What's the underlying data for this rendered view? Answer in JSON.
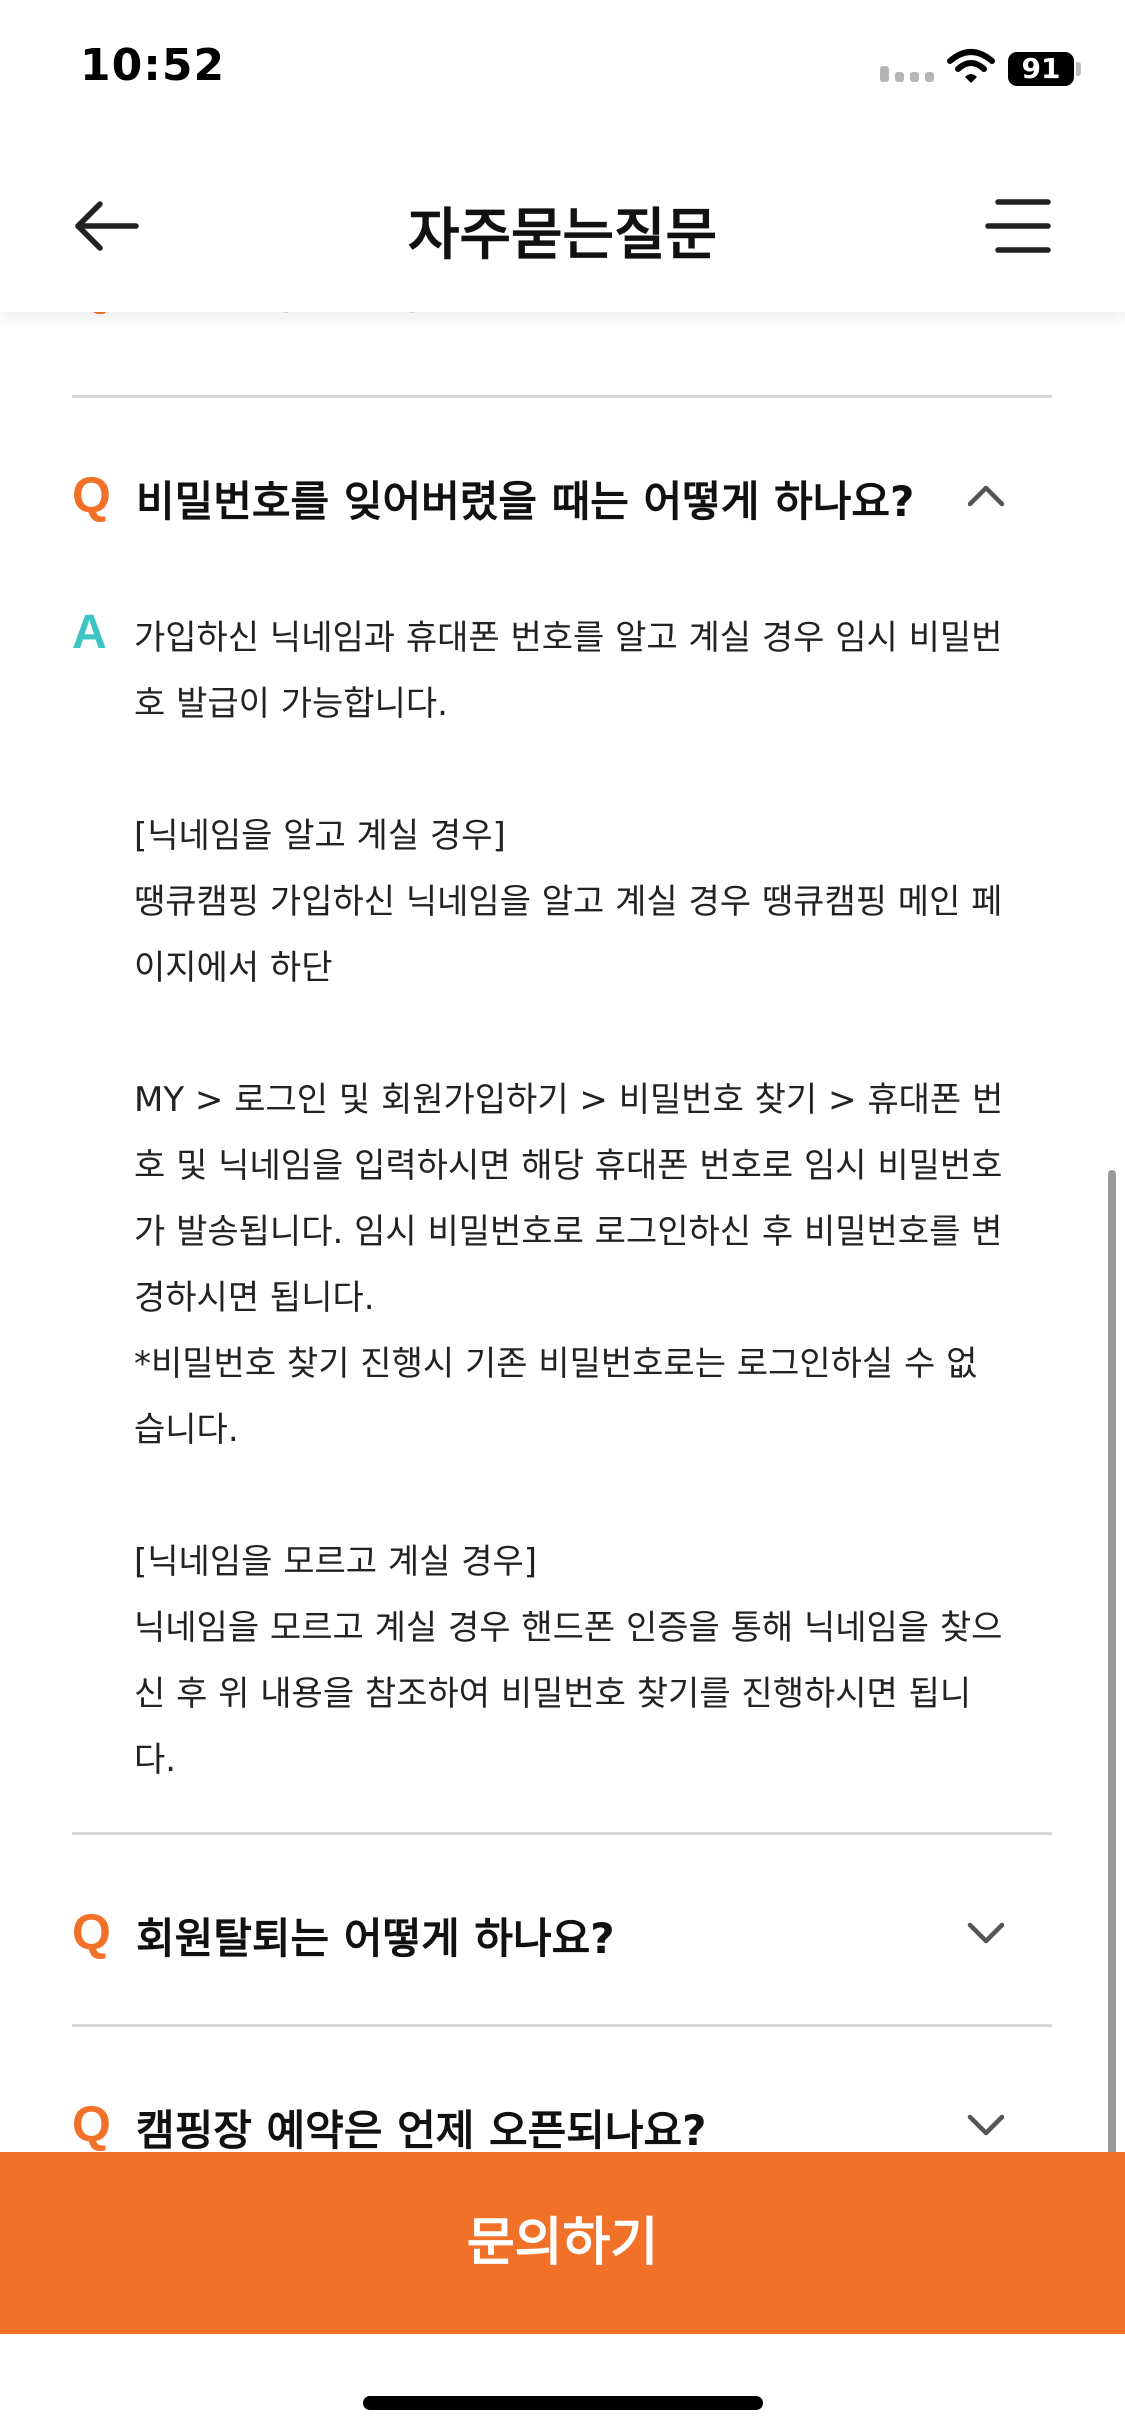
{
  "status": {
    "time": "10:52",
    "battery": "91"
  },
  "header": {
    "title": "자주묻는질문"
  },
  "faq": {
    "q_label": "Q",
    "a_label": "A",
    "partial_question": "광고란 무엇인가요?",
    "open_question": "비밀번호를 잊어버렸을 때는 어떻게 하나요?",
    "open_answer": "가입하신 닉네임과 휴대폰 번호를 알고 계실 경우 임시 비밀번\n호 발급이 가능합니다.\n\n[닉네임을 알고 계실 경우]\n땡큐캠핑 가입하신 닉네임을 알고 계실 경우 땡큐캠핑 메인 페\n이지에서 하단\n\nMY > 로그인 및 회원가입하기 > 비밀번호 찾기 > 휴대폰 번\n호 및 닉네임을 입력하시면 해당 휴대폰 번호로 임시 비밀번호\n가 발송됩니다. 임시 비밀번호로 로그인하신 후 비밀번호를 변\n경하시면 됩니다.\n*비밀번호 찾기 진행시 기존 비밀번호로는 로그인하실 수 없\n습니다.\n\n[닉네임을 모르고 계실 경우]\n닉네임을 모르고 계실 경우 핸드폰 인증을 통해 닉네임을 찾으\n신 후 위 내용을 참조하여 비밀번호 찾기를 진행하시면 됩니\n다.",
    "questions": [
      "회원탈퇴는 어떻게 하나요?",
      "캠핑장 예약은 언제 오픈되나요?"
    ]
  },
  "cta": {
    "label": "문의하기"
  },
  "colors": {
    "accent": "#f07127",
    "answer_mark": "#3ec5c3"
  }
}
